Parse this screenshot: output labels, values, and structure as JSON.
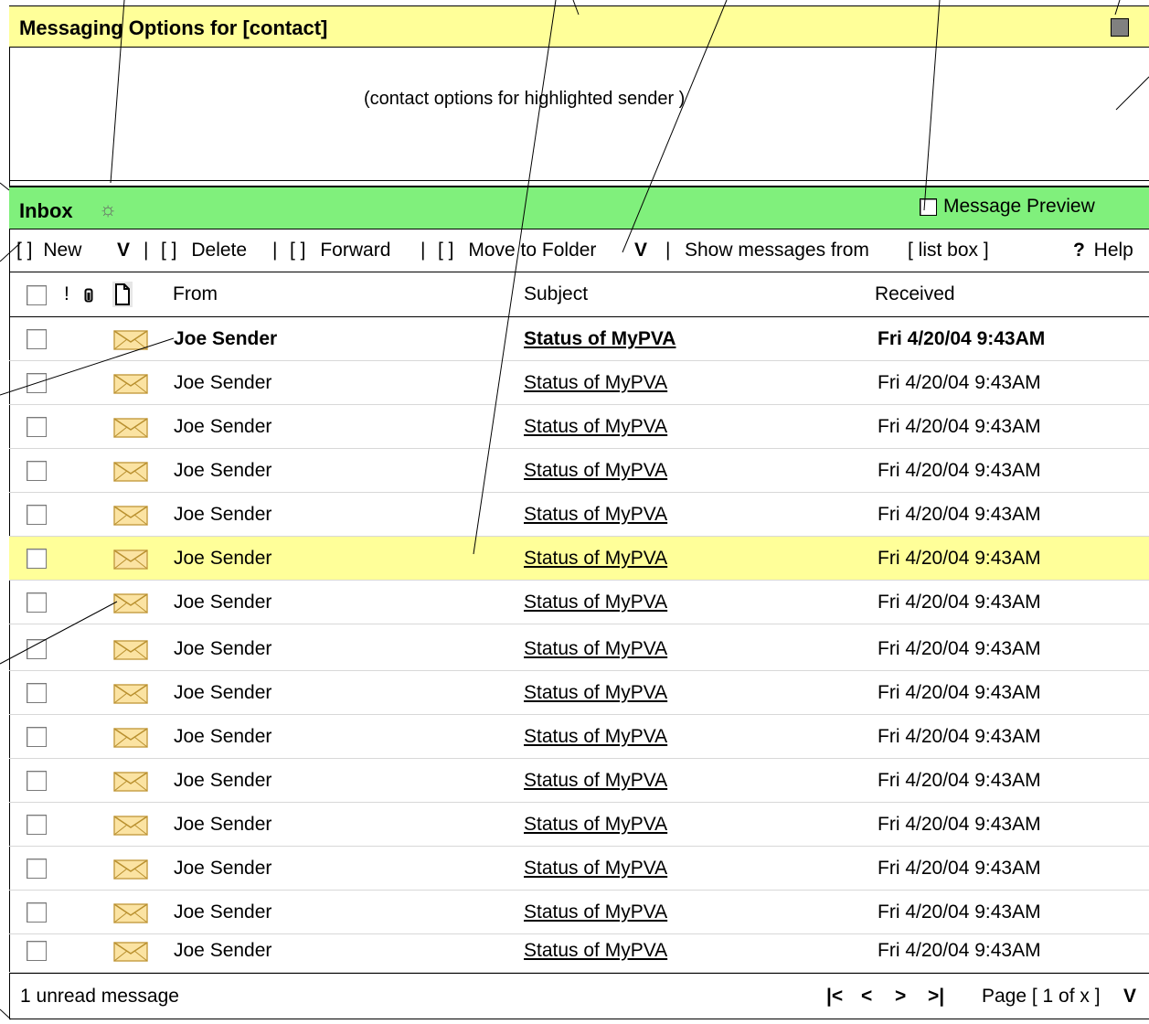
{
  "options_panel": {
    "title": "Messaging Options for [contact]",
    "hint": "(contact options for highlighted sender )"
  },
  "inbox": {
    "title": "Inbox",
    "preview_label": "Message Preview"
  },
  "toolbar": {
    "checkbox_glyph": "[ ]",
    "new_label": "New",
    "dropdown_glyph": "V",
    "separator": "|",
    "delete_label": "Delete",
    "forward_label": "Forward",
    "move_label": "Move to Folder",
    "show_from_label": "Show messages from",
    "list_box": "[ list box ]",
    "help_mark": "?",
    "help_label": "Help"
  },
  "columns": {
    "priority": "!",
    "from": "From",
    "subject": "Subject",
    "received": "Received"
  },
  "messages": [
    {
      "from": "Joe Sender",
      "subject": "Status of MyPVA",
      "received": "Fri 4/20/04 9:43AM",
      "unread": true,
      "highlighted": false
    },
    {
      "from": "Joe Sender",
      "subject": "Status of MyPVA",
      "received": "Fri 4/20/04 9:43AM",
      "unread": false,
      "highlighted": false
    },
    {
      "from": "Joe Sender",
      "subject": "Status of MyPVA",
      "received": "Fri 4/20/04 9:43AM",
      "unread": false,
      "highlighted": false
    },
    {
      "from": "Joe Sender",
      "subject": "Status of MyPVA",
      "received": "Fri 4/20/04 9:43AM",
      "unread": false,
      "highlighted": false
    },
    {
      "from": "Joe Sender",
      "subject": "Status of MyPVA",
      "received": "Fri 4/20/04 9:43AM",
      "unread": false,
      "highlighted": false
    },
    {
      "from": "Joe Sender",
      "subject": "Status of MyPVA",
      "received": "Fri 4/20/04 9:43AM",
      "unread": false,
      "highlighted": true
    },
    {
      "from": "Joe Sender",
      "subject": "Status of MyPVA",
      "received": "Fri 4/20/04 9:43AM",
      "unread": false,
      "highlighted": false
    },
    {
      "from": "Joe Sender",
      "subject": "Status of MyPVA",
      "received": "Fri 4/20/04 9:43AM",
      "unread": false,
      "highlighted": false
    },
    {
      "from": "Joe Sender",
      "subject": "Status of MyPVA",
      "received": "Fri 4/20/04 9:43AM",
      "unread": false,
      "highlighted": false
    },
    {
      "from": "Joe Sender",
      "subject": "Status of MyPVA",
      "received": "Fri 4/20/04 9:43AM",
      "unread": false,
      "highlighted": false
    },
    {
      "from": "Joe Sender",
      "subject": "Status of MyPVA",
      "received": "Fri 4/20/04 9:43AM",
      "unread": false,
      "highlighted": false
    },
    {
      "from": "Joe Sender",
      "subject": "Status of MyPVA",
      "received": "Fri 4/20/04 9:43AM",
      "unread": false,
      "highlighted": false
    },
    {
      "from": "Joe Sender",
      "subject": "Status of MyPVA",
      "received": "Fri 4/20/04 9:43AM",
      "unread": false,
      "highlighted": false
    },
    {
      "from": "Joe Sender",
      "subject": "Status of MyPVA",
      "received": "Fri 4/20/04 9:43AM",
      "unread": false,
      "highlighted": false
    },
    {
      "from": "Joe Sender",
      "subject": "Status of MyPVA",
      "received": "Fri 4/20/04 9:43AM",
      "unread": false,
      "highlighted": false
    }
  ],
  "footer": {
    "unread_count": "1 unread message",
    "nav_first": "|<",
    "nav_prev": "<",
    "nav_next": ">",
    "nav_last": ">|",
    "page_label": "Page [ 1 of x ]",
    "page_dropdown": "V"
  },
  "colors": {
    "options_header_bg": "#ffff99",
    "inbox_header_bg": "#80f07c",
    "highlight_row_bg": "#ffff99"
  },
  "icons": [
    "close-square-icon",
    "sun-icon",
    "attachment-icon",
    "document-icon",
    "envelope-icon"
  ]
}
